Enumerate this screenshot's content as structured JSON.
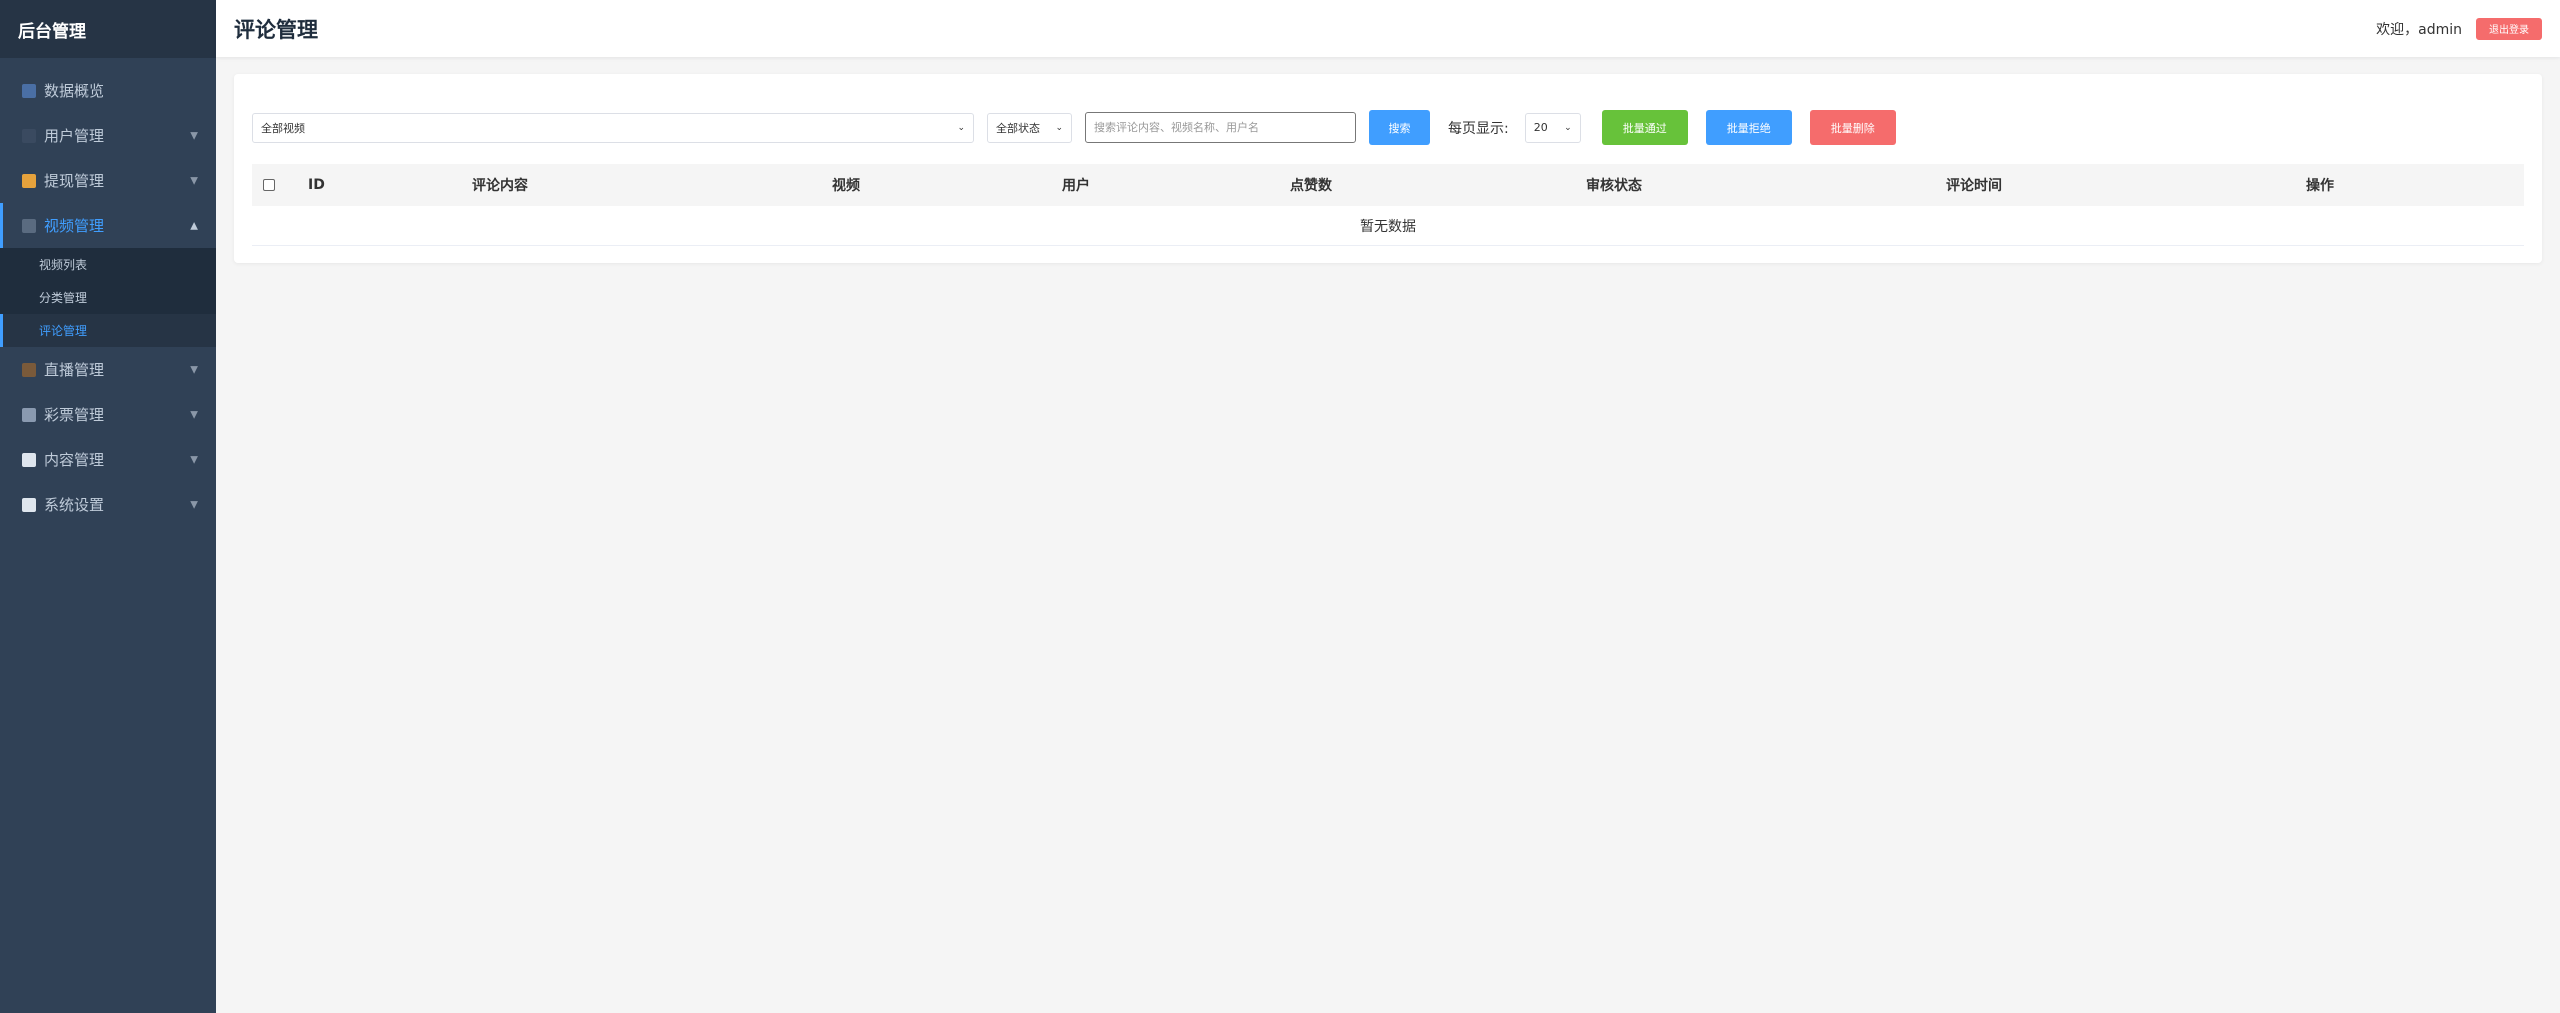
{
  "sidebar": {
    "brand": "后台管理",
    "menu": [
      {
        "label": "数据概览",
        "icon": "chart-icon"
      },
      {
        "label": "用户管理",
        "icon": "user-icon"
      },
      {
        "label": "提现管理",
        "icon": "money-bag-icon"
      },
      {
        "label": "视频管理",
        "icon": "film-icon"
      },
      {
        "label": "直播管理",
        "icon": "tv-icon"
      },
      {
        "label": "彩票管理",
        "icon": "lottery-icon"
      },
      {
        "label": "内容管理",
        "icon": "document-icon"
      },
      {
        "label": "系统设置",
        "icon": "gear-icon"
      }
    ],
    "video_submenu": [
      "视频列表",
      "分类管理",
      "评论管理"
    ]
  },
  "header": {
    "title": "评论管理",
    "welcome": "欢迎，admin",
    "logout": "退出登录"
  },
  "toolbar": {
    "video_filter": "全部视频",
    "status_filter": "全部状态",
    "search_placeholder": "搜索评论内容、视频名称、用户名",
    "search_button": "搜索",
    "per_page_label": "每页显示:",
    "per_page_value": "20",
    "batch_pass": "批量通过",
    "batch_reject": "批量拒绝",
    "batch_delete": "批量删除"
  },
  "table": {
    "columns": [
      "ID",
      "评论内容",
      "视频",
      "用户",
      "点赞数",
      "审核状态",
      "评论时间",
      "操作"
    ],
    "empty_text": "暂无数据"
  },
  "colors": {
    "sidebar_bg": "#304156",
    "accent": "#409eff",
    "success": "#67c23a",
    "danger": "#f56c6c"
  }
}
